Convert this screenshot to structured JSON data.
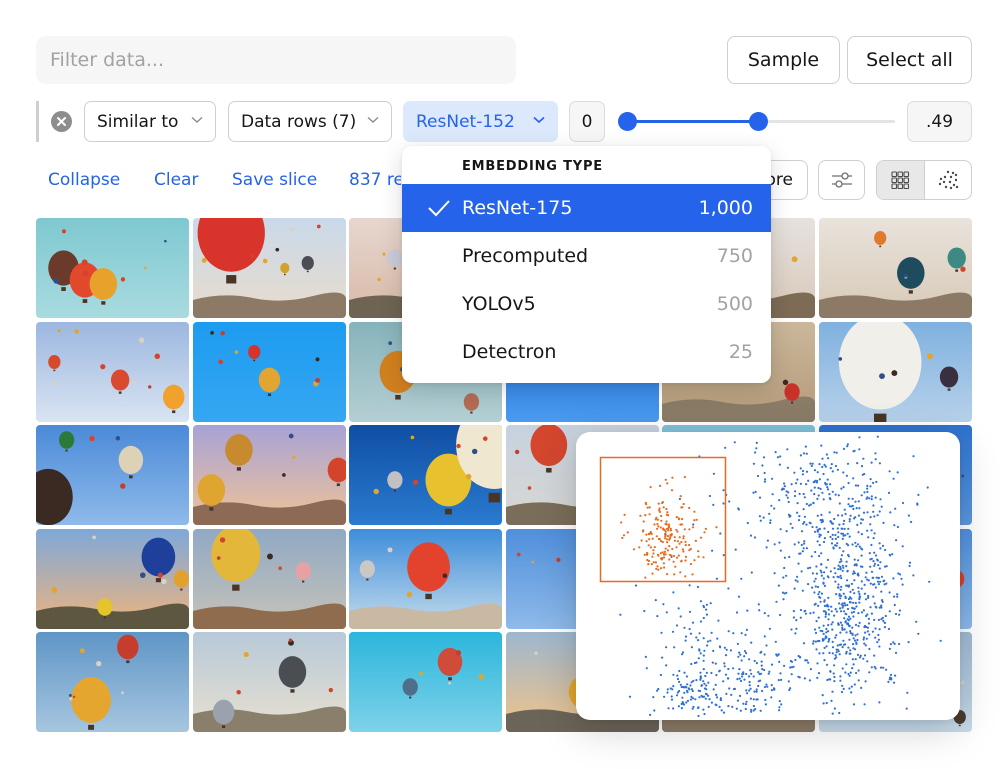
{
  "toolbar": {
    "filter_placeholder": "Filter data...",
    "filter_value": "",
    "sample_label": "Sample",
    "select_all_label": "Select all"
  },
  "query": {
    "operator": "Similar to",
    "target": "Data rows (7)",
    "embedding": "ResNet-152",
    "range_min": "0",
    "range_max": ".49",
    "slider_min_fraction": 0.0,
    "slider_max_fraction": 0.49
  },
  "actions": {
    "collapse": "Collapse",
    "clear": "Clear",
    "save_slice": "Save slice",
    "result_count": "837 re",
    "more_partial": "ore"
  },
  "icons": {
    "clear": "clear-circle-icon",
    "chevron": "chevron-down-icon",
    "settings": "sliders-icon",
    "grid_view": "grid-view-icon",
    "scatter_view": "scatter-view-icon",
    "check": "check-icon"
  },
  "dropdown": {
    "header": "EMBEDDING TYPE",
    "items": [
      {
        "label": "ResNet-175",
        "count": "1,000",
        "selected": true
      },
      {
        "label": "Precomputed",
        "count": "750",
        "selected": false
      },
      {
        "label": "YOLOv5",
        "count": "500",
        "selected": false
      },
      {
        "label": "Detectron",
        "count": "25",
        "selected": false
      }
    ]
  },
  "grid": {
    "columns": 6,
    "rows": 5,
    "tiles": [
      {
        "sky": [
          "#7fc8d0",
          "#a8dbe0"
        ],
        "balloons": [
          [
            0.18,
            0.5,
            0.1,
            "#6b3a2a"
          ],
          [
            0.32,
            0.62,
            0.1,
            "#e2492c"
          ],
          [
            0.44,
            0.66,
            0.09,
            "#e8a12a"
          ]
        ],
        "ground": null
      },
      {
        "sky": [
          "#c9d9ea",
          "#e9dccc"
        ],
        "balloons": [
          [
            0.25,
            0.15,
            0.22,
            "#d9342b"
          ],
          [
            0.6,
            0.5,
            0.03,
            "#d2a32c"
          ],
          [
            0.75,
            0.45,
            0.04,
            "#4c4c55"
          ]
        ],
        "ground": "#8c7a66"
      },
      {
        "sky": [
          "#e7d6cf",
          "#d8b9a7"
        ],
        "balloons": [
          [
            0.3,
            0.4,
            0.05,
            "#c9ccd8"
          ]
        ],
        "ground": "#6f6453"
      },
      {
        "sky": [
          "#2f8de0",
          "#6ab7f4"
        ],
        "balloons": [],
        "ground": null
      },
      {
        "sky": [
          "#e6e2df",
          "#d8c8b8"
        ],
        "balloons": [
          [
            0.3,
            0.3,
            0.04,
            "#2a3b66"
          ]
        ],
        "ground": "#7d6b56"
      },
      {
        "sky": [
          "#e9e3dc",
          "#d7c9b6"
        ],
        "balloons": [
          [
            0.4,
            0.2,
            0.04,
            "#e07a2b"
          ],
          [
            0.6,
            0.55,
            0.09,
            "#1f4b5e"
          ],
          [
            0.9,
            0.4,
            0.06,
            "#3d8a84"
          ]
        ],
        "ground": "#8c7a66"
      },
      {
        "sky": [
          "#9cb7df",
          "#d9e4f2"
        ],
        "balloons": [
          [
            0.12,
            0.4,
            0.04,
            "#d44a2a"
          ],
          [
            0.9,
            0.75,
            0.07,
            "#f2a12c"
          ],
          [
            0.55,
            0.58,
            0.06,
            "#d94a2e"
          ]
        ],
        "ground": null
      },
      {
        "sky": [
          "#1d9bf0",
          "#35a7f2"
        ],
        "balloons": [
          [
            0.5,
            0.58,
            0.07,
            "#e2a532"
          ],
          [
            0.4,
            0.3,
            0.04,
            "#d3342c"
          ]
        ],
        "ground": null
      },
      {
        "sky": [
          "#86b3bb",
          "#b4cfd3"
        ],
        "balloons": [
          [
            0.32,
            0.5,
            0.12,
            "#d2801f"
          ],
          [
            0.8,
            0.8,
            0.05,
            "#b46b55"
          ]
        ],
        "ground": null
      },
      {
        "sky": [
          "#1e6fd9",
          "#4a9af0"
        ],
        "balloons": [
          [
            0.55,
            0.1,
            0.03,
            "#d44a2a"
          ]
        ],
        "ground": null
      },
      {
        "sky": [
          "#cbb79b",
          "#b49a79"
        ],
        "balloons": [
          [
            0.85,
            0.7,
            0.05,
            "#c8302a"
          ]
        ],
        "ground": "#8a7c66"
      },
      {
        "sky": [
          "#7fb1df",
          "#b7d1ea"
        ],
        "balloons": [
          [
            0.4,
            0.4,
            0.27,
            "#f0efe9"
          ],
          [
            0.85,
            0.55,
            0.06,
            "#3a2f3f"
          ]
        ],
        "ground": null
      },
      {
        "sky": [
          "#4b8ad8",
          "#8fbaea"
        ],
        "balloons": [
          [
            0.08,
            0.72,
            0.16,
            "#3b2a22"
          ],
          [
            0.62,
            0.35,
            0.08,
            "#ddd2b8"
          ],
          [
            0.2,
            0.15,
            0.05,
            "#2c7a3a"
          ]
        ],
        "ground": null
      },
      {
        "sky": [
          "#a7a2d6",
          "#f0c398"
        ],
        "balloons": [
          [
            0.3,
            0.25,
            0.09,
            "#c88a2f"
          ],
          [
            0.12,
            0.65,
            0.09,
            "#e0a530"
          ],
          [
            0.95,
            0.45,
            0.07,
            "#d4442b"
          ]
        ],
        "ground": "#8c6a56"
      },
      {
        "sky": [
          "#0f4ea3",
          "#2a7bd0"
        ],
        "balloons": [
          [
            0.65,
            0.55,
            0.15,
            "#e8c22e"
          ],
          [
            0.95,
            0.2,
            0.25,
            "#efe7cf"
          ],
          [
            0.3,
            0.55,
            0.05,
            "#c2c0c0"
          ]
        ],
        "ground": null
      },
      {
        "sky": [
          "#c7d2df",
          "#d8d7d3"
        ],
        "balloons": [
          [
            0.28,
            0.2,
            0.12,
            "#d4462e"
          ],
          [
            0.55,
            0.35,
            0.09,
            "#e0b434"
          ]
        ],
        "ground": "#7a6e5a"
      },
      {
        "sky": [
          "#7cc0d8",
          "#b6d9e2"
        ],
        "balloons": [],
        "ground": null
      },
      {
        "sky": [
          "#2d72cf",
          "#5b99e0"
        ],
        "balloons": [],
        "ground": null
      },
      {
        "sky": [
          "#7ea8d9",
          "#f0b47c"
        ],
        "balloons": [
          [
            0.8,
            0.28,
            0.11,
            "#1e3f9a"
          ],
          [
            0.45,
            0.78,
            0.05,
            "#e4c42c"
          ],
          [
            0.95,
            0.5,
            0.05,
            "#e0a22f"
          ]
        ],
        "ground": "#5d5742"
      },
      {
        "sky": [
          "#90a9c4",
          "#c7c3b8"
        ],
        "balloons": [
          [
            0.28,
            0.25,
            0.16,
            "#e3b83a"
          ],
          [
            0.72,
            0.42,
            0.05,
            "#e8a1a3"
          ]
        ],
        "ground": "#8e6c4d"
      },
      {
        "sky": [
          "#3e8ddb",
          "#c5dceb"
        ],
        "balloons": [
          [
            0.52,
            0.38,
            0.14,
            "#e3432c"
          ],
          [
            0.12,
            0.4,
            0.05,
            "#cbc7c2"
          ]
        ],
        "ground": "#c9b9a2"
      },
      {
        "sky": [
          "#4f8fdc",
          "#8fbaea"
        ],
        "balloons": [
          [
            0.5,
            0.3,
            0.04,
            "#2a3a4a"
          ]
        ],
        "ground": null
      },
      {
        "sky": [
          "#4f8fdc",
          "#8fbaea"
        ],
        "balloons": [],
        "ground": null
      },
      {
        "sky": [
          "#4f8fdc",
          "#8fbaea"
        ],
        "balloons": [
          [
            0.9,
            0.5,
            0.05,
            "#d4442b"
          ]
        ],
        "ground": null
      },
      {
        "sky": [
          "#5f95c6",
          "#a6c6df"
        ],
        "balloons": [
          [
            0.36,
            0.68,
            0.13,
            "#e4a62e"
          ],
          [
            0.6,
            0.15,
            0.07,
            "#c63c2d"
          ]
        ],
        "ground": null
      },
      {
        "sky": [
          "#b7c9d8",
          "#e8e0d0"
        ],
        "balloons": [
          [
            0.65,
            0.4,
            0.09,
            "#4a4e52"
          ],
          [
            0.2,
            0.8,
            0.07,
            "#9aa3ad"
          ]
        ],
        "ground": "#8a7f6b"
      },
      {
        "sky": [
          "#2bb6dc",
          "#7ed2e8"
        ],
        "balloons": [
          [
            0.66,
            0.3,
            0.08,
            "#cf4b3a"
          ],
          [
            0.4,
            0.55,
            0.05,
            "#4f6e8a"
          ]
        ],
        "ground": null
      },
      {
        "sky": [
          "#9db7cf",
          "#f2c387"
        ],
        "balloons": [
          [
            0.5,
            0.6,
            0.09,
            "#e2a52c"
          ]
        ],
        "ground": "#6b6458"
      },
      {
        "sky": [
          "#c9d4de",
          "#b7a68e"
        ],
        "balloons": [],
        "ground": "#8c7a66"
      },
      {
        "sky": [
          "#9fb9d3",
          "#c7dbea"
        ],
        "balloons": [
          [
            0.92,
            0.85,
            0.04,
            "#4a3b2c"
          ]
        ],
        "ground": null
      }
    ]
  },
  "embedding_view": {
    "selection_color": "#e86a1a",
    "point_color": "#2f6fd6",
    "selected_count_approx": 200,
    "total_points_approx": 1300
  },
  "colors": {
    "accent": "#2563eb",
    "accent_light": "#dce8fc",
    "selection": "#e86a1a"
  }
}
